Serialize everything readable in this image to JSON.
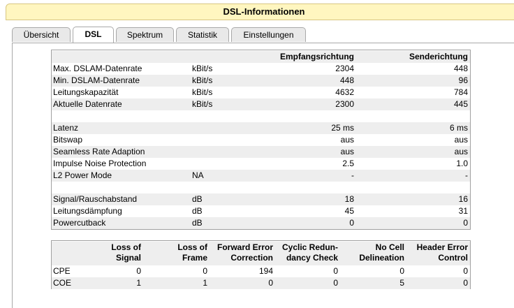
{
  "title": "DSL-Informationen",
  "tabs": [
    "Übersicht",
    "DSL",
    "Spektrum",
    "Statistik",
    "Einstellungen"
  ],
  "active_tab": "DSL",
  "info_table": {
    "headers": [
      "",
      "",
      "Empfangsrichtung",
      "Senderichtung"
    ],
    "rows": [
      {
        "label": "Max. DSLAM-Datenrate",
        "unit": "kBit/s",
        "down": "2304",
        "up": "448"
      },
      {
        "label": "Min. DSLAM-Datenrate",
        "unit": "kBit/s",
        "down": "448",
        "up": "96"
      },
      {
        "label": "Leitungskapazität",
        "unit": "kBit/s",
        "down": "4632",
        "up": "784"
      },
      {
        "label": "Aktuelle Datenrate",
        "unit": "kBit/s",
        "down": "2300",
        "up": "445"
      },
      {
        "label": "",
        "unit": "",
        "down": "",
        "up": ""
      },
      {
        "label": "Latenz",
        "unit": "",
        "down": "25 ms",
        "up": "6 ms"
      },
      {
        "label": "Bitswap",
        "unit": "",
        "down": "aus",
        "up": "aus"
      },
      {
        "label": "Seamless Rate Adaption",
        "unit": "",
        "down": "aus",
        "up": "aus"
      },
      {
        "label": "Impulse Noise Protection",
        "unit": "",
        "down": "2.5",
        "up": "1.0"
      },
      {
        "label": "L2 Power Mode",
        "unit": "NA",
        "down": "-",
        "up": "-"
      },
      {
        "label": "",
        "unit": "",
        "down": "",
        "up": ""
      },
      {
        "label": "Signal/Rauschabstand",
        "unit": "dB",
        "down": "18",
        "up": "16"
      },
      {
        "label": "Leitungsdämpfung",
        "unit": "dB",
        "down": "45",
        "up": "31"
      },
      {
        "label": "Powercutback",
        "unit": "dB",
        "down": "0",
        "up": "0"
      }
    ]
  },
  "error_table": {
    "headers": [
      [
        "Loss of",
        "Signal"
      ],
      [
        "Loss of",
        "Frame"
      ],
      [
        "Forward Error",
        "Correction"
      ],
      [
        "Cyclic Redun-",
        "dancy Check"
      ],
      [
        "No Cell",
        "Delineation"
      ],
      [
        "Header Error",
        "Control"
      ]
    ],
    "rows": [
      {
        "label": "CPE",
        "values": [
          "0",
          "0",
          "194",
          "0",
          "0",
          "0"
        ]
      },
      {
        "label": "COE",
        "values": [
          "1",
          "1",
          "0",
          "0",
          "5",
          "0"
        ]
      }
    ]
  }
}
